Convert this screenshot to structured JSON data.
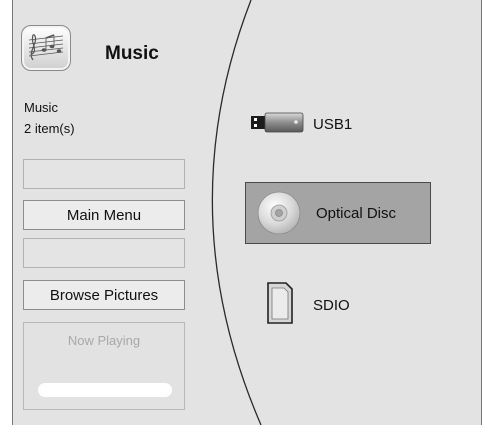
{
  "header": {
    "title": "Music",
    "icon": "music-score-icon"
  },
  "info": {
    "category": "Music",
    "item_count": "2 item(s)"
  },
  "sidebar": {
    "buttons": [
      {
        "label": ""
      },
      {
        "label": "Main Menu"
      },
      {
        "label": ""
      },
      {
        "label": "Browse Pictures"
      }
    ],
    "now_playing": {
      "label": "Now Playing",
      "progress": 1.0
    }
  },
  "devices": [
    {
      "label": "USB1",
      "icon": "usb-drive-icon",
      "selected": false
    },
    {
      "label": "Optical Disc",
      "icon": "optical-disc-icon",
      "selected": true
    },
    {
      "label": "SDIO",
      "icon": "sd-card-icon",
      "selected": false
    }
  ],
  "colors": {
    "panel_bg": "#e3e3e3",
    "selected_bg": "#a4a4a4",
    "now_playing_text": "#a8a8a8"
  }
}
